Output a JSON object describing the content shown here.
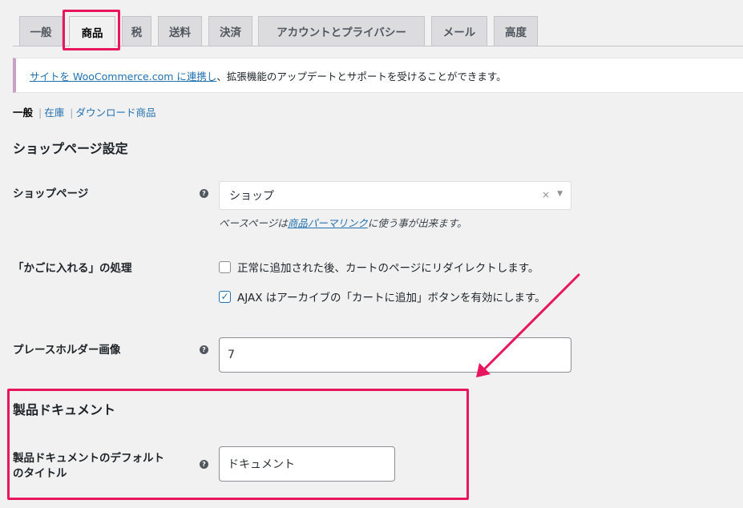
{
  "tabs": [
    {
      "label": "一般"
    },
    {
      "label": "商品"
    },
    {
      "label": "税"
    },
    {
      "label": "送料"
    },
    {
      "label": "決済"
    },
    {
      "label": "アカウントとプライバシー"
    },
    {
      "label": "メール"
    },
    {
      "label": "高度"
    }
  ],
  "notice": {
    "link_text": "サイトを WooCommerce.com に連携し",
    "rest_text": "、拡張機能のアップデートとサポートを受けることができます。"
  },
  "subnav": {
    "current": "一般",
    "links": [
      "在庫",
      "ダウンロード商品"
    ],
    "separator": "|"
  },
  "shop_section": {
    "heading": "ショップページ設定",
    "shop_page_label": "ショップページ",
    "shop_page_value": "ショップ",
    "shop_page_desc_prefix": "ベースページは",
    "shop_page_desc_link": "商品パーマリンク",
    "shop_page_desc_suffix": "に使う事が出来ます。",
    "add_to_cart_label": "「かごに入れる」の処理",
    "redirect_option": "正常に追加された後、カートのページにリダイレクトします。",
    "redirect_checked": false,
    "ajax_option": "AJAX はアーカイブの「カートに追加」ボタンを有効にします。",
    "ajax_checked": true,
    "placeholder_label": "プレースホルダー画像",
    "placeholder_value": "7"
  },
  "doc_section": {
    "heading": "製品ドキュメント",
    "default_title_label_1": "製品ドキュメントのデフォルト",
    "default_title_label_2": "のタイトル",
    "default_title_value": "ドキュメント"
  },
  "icons": {
    "help": "?",
    "clear": "×",
    "dropdown": "▼",
    "check": "✓"
  },
  "colors": {
    "highlight": "#e8175d",
    "link": "#2271b1"
  }
}
